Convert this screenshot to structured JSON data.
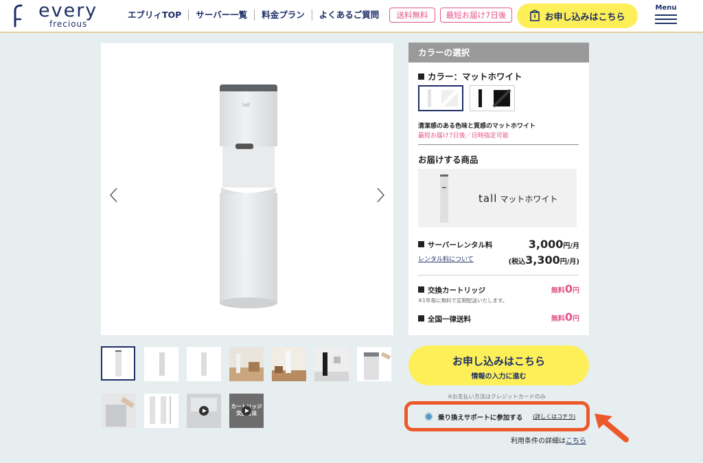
{
  "header": {
    "logo_text": "every",
    "logo_sub": "frecious",
    "nav": [
      "エブリィTOP",
      "サーバー一覧",
      "料金プラン",
      "よくあるご質問"
    ],
    "tags": [
      "送料無料",
      "最短お届け7日後"
    ],
    "cta_label": "お申し込みはこちら",
    "menu_label": "Menu"
  },
  "gallery": {
    "thumbnails": [
      {
        "kind": "server-white",
        "caption": ""
      },
      {
        "kind": "server-white-side",
        "caption": ""
      },
      {
        "kind": "server-white-angle",
        "caption": ""
      },
      {
        "kind": "room-scene",
        "caption": ""
      },
      {
        "kind": "room-scene-2",
        "caption": ""
      },
      {
        "kind": "server-black-room",
        "caption": ""
      },
      {
        "kind": "server-top-open",
        "caption": ""
      },
      {
        "kind": "cartridge-hand",
        "caption": ""
      },
      {
        "kind": "size-diagram",
        "caption": ""
      },
      {
        "kind": "video-1",
        "caption": ""
      },
      {
        "kind": "video-2",
        "caption": "カートリッジ\n交換方法"
      }
    ]
  },
  "panel": {
    "header": "カラーの選択",
    "color_title": "カラー：マットホワイト",
    "colors": [
      {
        "name": "マットホワイト",
        "selected": true,
        "hex": "#ececec"
      },
      {
        "name": "マットブラック",
        "selected": false,
        "hex": "#111111"
      }
    ],
    "description": "清潔感のある色味と質感のマットホワイト",
    "delivery_note": "最短お届け7日後／日時指定可能",
    "products_title": "お届けする商品",
    "product_brand": "tall",
    "product_color": "マットホワイト",
    "rental_label": "サーバーレンタル料",
    "rental_link": "レンタル料について",
    "rental_price": "3,000",
    "rental_unit": "円/月",
    "rental_tax_prefix": "(税込",
    "rental_tax_price": "3,300",
    "rental_tax_unit": "円/月)",
    "cartridge_label": "交換カートリッジ",
    "cartridge_note": "※1年毎に無料で定期配送いたします。",
    "free_prefix": "無料",
    "free_value": "0",
    "free_unit": "円",
    "shipping_label": "全国一律送料"
  },
  "apply": {
    "main": "お申し込みはこちら",
    "sub": "情報の入力に進む",
    "pay_note": "※お支払い方法はクレジットカードのみ",
    "support_label": "乗り換えサポートに参加する",
    "support_link": "(詳しくはコチラ)",
    "terms_text": "利用条件の詳細は",
    "terms_link": "こちら"
  },
  "colors": {
    "navy": "#1d2e66",
    "yellow": "#fdef58",
    "pink": "#e3548a",
    "highlight": "#ec5a2b"
  }
}
